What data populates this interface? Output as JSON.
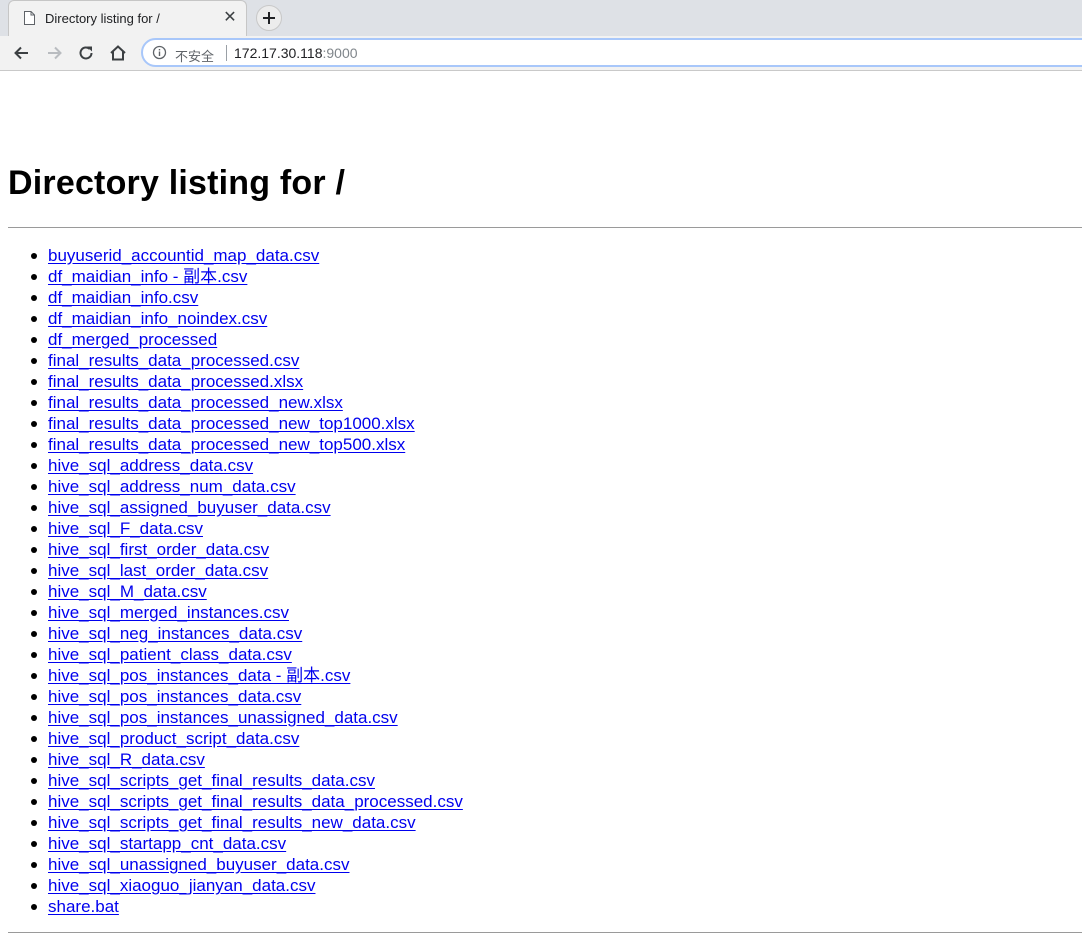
{
  "browser": {
    "tab_title": "Directory listing for /",
    "tab_close_glyph": "✕",
    "security_label": "不安全",
    "url_host": "172.17.30.118",
    "url_port": ":9000"
  },
  "page": {
    "heading": "Directory listing for /",
    "files": [
      "buyuserid_accountid_map_data.csv",
      "df_maidian_info - 副本.csv",
      "df_maidian_info.csv",
      "df_maidian_info_noindex.csv",
      "df_merged_processed",
      "final_results_data_processed.csv",
      "final_results_data_processed.xlsx",
      "final_results_data_processed_new.xlsx",
      "final_results_data_processed_new_top1000.xlsx",
      "final_results_data_processed_new_top500.xlsx",
      "hive_sql_address_data.csv",
      "hive_sql_address_num_data.csv",
      "hive_sql_assigned_buyuser_data.csv",
      "hive_sql_F_data.csv",
      "hive_sql_first_order_data.csv",
      "hive_sql_last_order_data.csv",
      "hive_sql_M_data.csv",
      "hive_sql_merged_instances.csv",
      "hive_sql_neg_instances_data.csv",
      "hive_sql_patient_class_data.csv",
      "hive_sql_pos_instances_data - 副本.csv",
      "hive_sql_pos_instances_data.csv",
      "hive_sql_pos_instances_unassigned_data.csv",
      "hive_sql_product_script_data.csv",
      "hive_sql_R_data.csv",
      "hive_sql_scripts_get_final_results_data.csv",
      "hive_sql_scripts_get_final_results_data_processed.csv",
      "hive_sql_scripts_get_final_results_new_data.csv",
      "hive_sql_startapp_cnt_data.csv",
      "hive_sql_unassigned_buyuser_data.csv",
      "hive_sql_xiaoguo_jianyan_data.csv",
      "share.bat"
    ]
  },
  "icons": {
    "tab_page": "page-icon",
    "new_tab": "plus-icon",
    "back": "arrow-left-icon",
    "forward": "arrow-right-icon",
    "reload": "reload-icon",
    "home": "home-icon",
    "site_info": "info-icon"
  },
  "colors": {
    "link": "#0000ee",
    "chrome_bg": "#dee1e6",
    "toolbar_bg": "#f2f2f2",
    "omnibox_focus": "#a8c7fa"
  }
}
